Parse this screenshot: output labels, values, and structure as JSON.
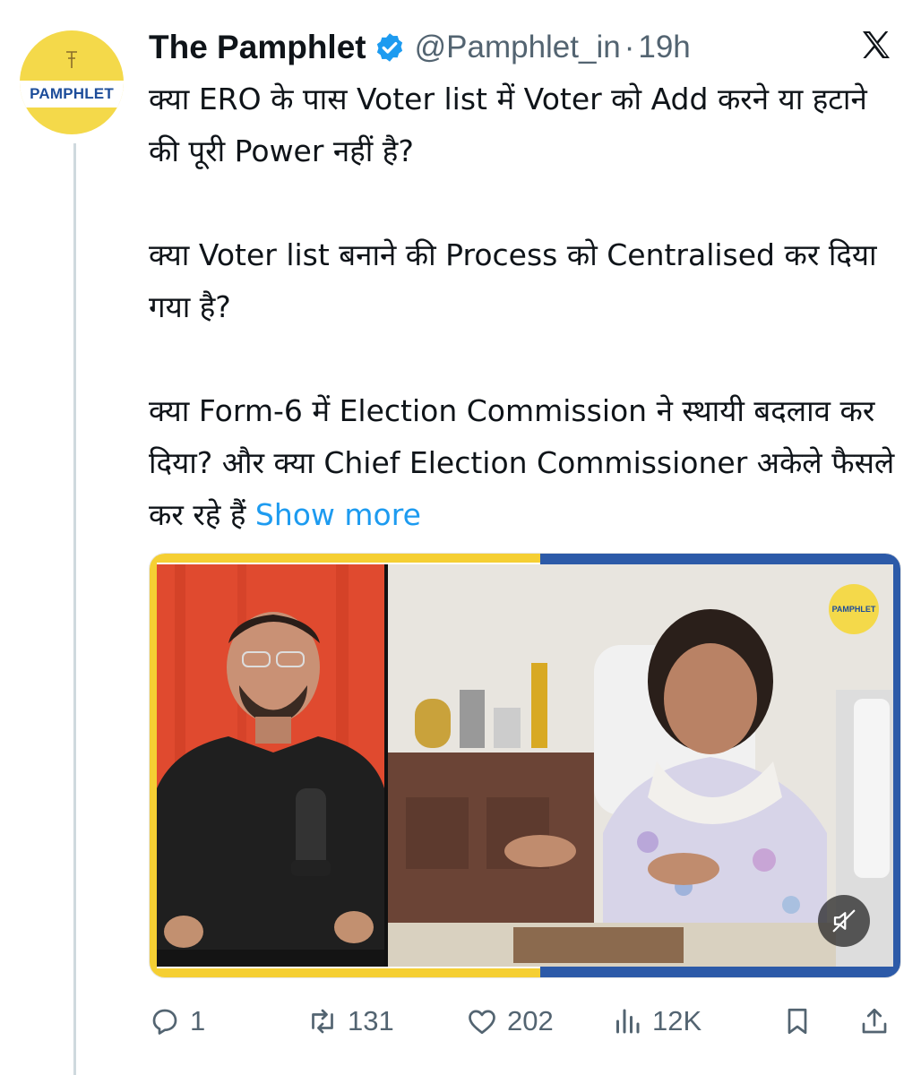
{
  "tweet": {
    "author_name": "The Pamphlet",
    "handle": "@Pamphlet_in",
    "separator": "·",
    "time": "19h",
    "avatar_text": "PAMPHLET",
    "paragraphs": [
      "क्या ERO के पास Voter list में Voter को Add करने या हटाने की पूरी Power नहीं है?",
      "क्या Voter list बनाने की Process को Centralised कर दिया गया है?",
      "क्या Form-6 में Election Commission ने स्थायी बदलाव कर दिया? और क्या Chief Election Commissioner अकेले फैसले कर रहे हैं"
    ],
    "show_more": "Show more"
  },
  "media": {
    "badge_text": "PAMPHLET"
  },
  "actions": {
    "replies": "1",
    "reposts": "131",
    "likes": "202",
    "views": "12K"
  },
  "icons": [
    "x-logo-icon",
    "verified-badge-icon",
    "reply-icon",
    "repost-icon",
    "like-icon",
    "views-icon",
    "bookmark-icon",
    "share-icon",
    "mute-icon"
  ],
  "colors": {
    "accent": "#1d9bf0",
    "secondary_text": "#536471",
    "brand_yellow": "#f4d94a",
    "brand_blue": "#1d4d9a"
  }
}
